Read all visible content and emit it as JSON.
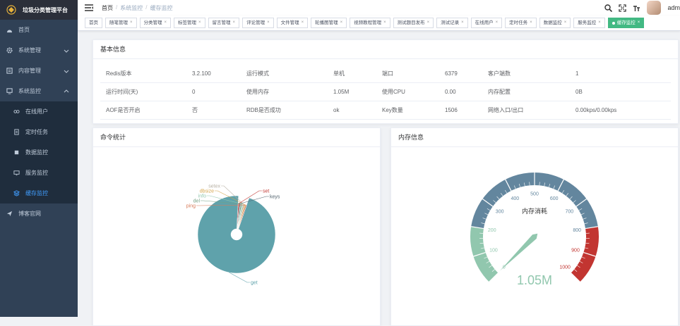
{
  "app": {
    "title": "垃圾分类管理平台"
  },
  "sidebar": {
    "items": [
      {
        "label": "首页",
        "icon": "dashboard-icon"
      },
      {
        "label": "系统管理",
        "icon": "gear-icon",
        "expandable": true
      },
      {
        "label": "内容管理",
        "icon": "document-icon",
        "expandable": true
      },
      {
        "label": "系统监控",
        "icon": "monitor-icon",
        "expandable": true,
        "expanded": true
      }
    ],
    "submenu": [
      {
        "label": "在线用户",
        "icon": "online-icon"
      },
      {
        "label": "定时任务",
        "icon": "job-icon"
      },
      {
        "label": "数据监控",
        "icon": "druid-icon"
      },
      {
        "label": "服务监控",
        "icon": "server-icon"
      },
      {
        "label": "缓存监控",
        "icon": "redis-icon",
        "active": true
      }
    ],
    "blog": {
      "label": "博客官网",
      "icon": "send-icon"
    }
  },
  "breadcrumb": {
    "home": "首页",
    "parent": "系统监控",
    "current": "缓存监控"
  },
  "navbar": {
    "username": "adm"
  },
  "tags": [
    "首页",
    "随笔管理",
    "分类管理",
    "标签管理",
    "留言管理",
    "评论管理",
    "文件管理",
    "轮播图管理",
    "视频教程管理",
    "测试题目发布",
    "测试记录",
    "在线用户",
    "定时任务",
    "数据监控",
    "服务监控",
    "缓存监控"
  ],
  "active_tag": "缓存监控",
  "basic_info": {
    "title": "基本信息",
    "rows": [
      [
        {
          "label": "Redis版本",
          "value": "3.2.100"
        },
        {
          "label": "运行模式",
          "value": "单机"
        },
        {
          "label": "端口",
          "value": "6379"
        },
        {
          "label": "客户端数",
          "value": "1"
        }
      ],
      [
        {
          "label": "运行时间(天)",
          "value": "0"
        },
        {
          "label": "使用内存",
          "value": "1.05M"
        },
        {
          "label": "使用CPU",
          "value": "0.00"
        },
        {
          "label": "内存配置",
          "value": "0B"
        }
      ],
      [
        {
          "label": "AOF是否开启",
          "value": "否"
        },
        {
          "label": "RDB是否成功",
          "value": "ok"
        },
        {
          "label": "Key数量",
          "value": "1506"
        },
        {
          "label": "网络入口/出口",
          "value": "0.00kps/0.00kps"
        }
      ]
    ]
  },
  "command_stats": {
    "title": "命令统计",
    "chart_data": {
      "type": "pie",
      "donut": true,
      "labels": [
        "get",
        "ping",
        "dbsize",
        "info",
        "setex",
        "del",
        "set",
        "keys"
      ],
      "values": [
        950,
        3,
        2,
        2,
        2,
        1,
        1,
        1
      ],
      "colors": [
        "#5fa2ab",
        "#d87c5b",
        "#d5a54b",
        "#91c7ae",
        "#b7b0a4",
        "#749f83",
        "#c23531",
        "#546570"
      ]
    }
  },
  "memory_info": {
    "title": "内存信息",
    "chart_data": {
      "type": "gauge",
      "name": "内存消耗",
      "value": 1.05,
      "value_label": "1.05M",
      "min": 0,
      "max": 1000,
      "ticks": [
        0,
        100,
        200,
        300,
        400,
        500,
        600,
        700,
        800,
        900,
        1000
      ],
      "bands": [
        {
          "to": 0.2,
          "color": "#91c7ae"
        },
        {
          "to": 0.8,
          "color": "#63869e"
        },
        {
          "to": 1.0,
          "color": "#c23531"
        }
      ]
    }
  }
}
